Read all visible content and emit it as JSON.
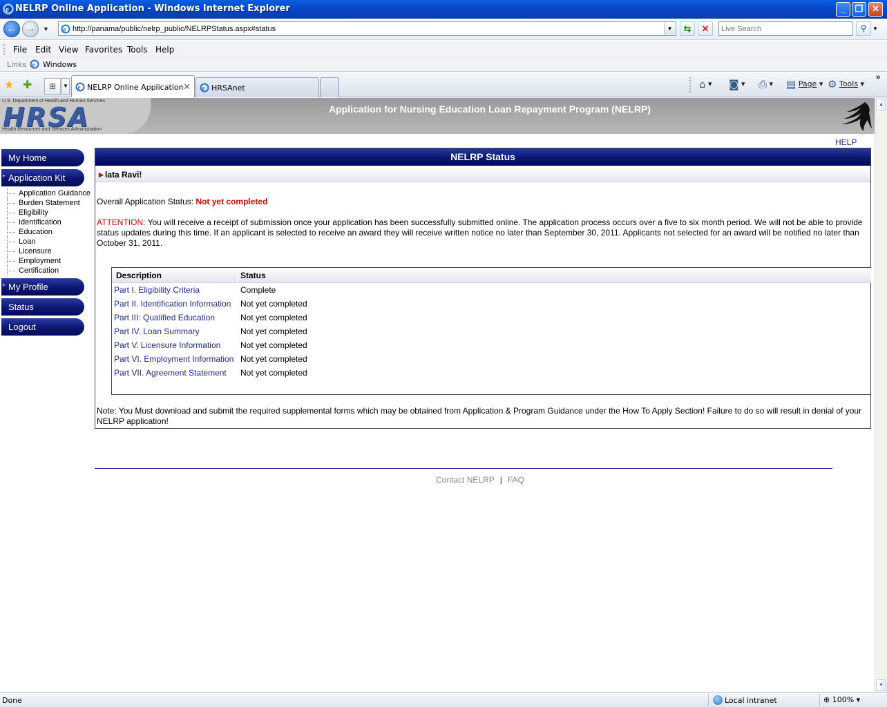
{
  "window": {
    "title": "NELRP Online Application - Windows Internet Explorer",
    "minimize": "_",
    "maximize": "❐",
    "close": "✕"
  },
  "addressbar": {
    "url": "http://panama/public/nelrp_public/NELRPStatus.aspx#status",
    "search_placeholder": "Live Search"
  },
  "menu": {
    "items": [
      "File",
      "Edit",
      "View",
      "Favorites",
      "Tools",
      "Help"
    ]
  },
  "links_bar": {
    "label": "Links",
    "link": "Windows"
  },
  "tabs": [
    {
      "label": "NELRP Online Application",
      "active": true
    },
    {
      "label": "HRSAnet",
      "active": false
    }
  ],
  "command_bar": {
    "page": "Page",
    "tools": "Tools"
  },
  "header": {
    "dept": "U.S. Department of Health and Human Services",
    "logo": "HRSA",
    "agency": "Health Resources and Services Administration",
    "app_title": "Application for Nursing Education Loan Repayment Program (NELRP)",
    "help": "HELP"
  },
  "sidebar": {
    "my_home": "My Home",
    "application_kit": "Application Kit",
    "kit_items": [
      "Application Guidance",
      "Burden Statement",
      "Eligibility",
      "Identification",
      "Education",
      "Loan",
      "Licensure",
      "Employment",
      "Certification"
    ],
    "my_profile": "My Profile",
    "status": "Status",
    "logout": "Logout",
    "plus": "+"
  },
  "panel": {
    "title": "NELRP Status",
    "greeting": "lata Ravi!",
    "overall_label": "Overall Application Status:",
    "overall_value": "Not yet completed",
    "attention_label": "ATTENTION:",
    "attention_text": "You will receive a receipt of submission once your application has been successfully submitted online. The application process occurs over a five to six month period. We will not be able to provide status updates during this time. If an applicant is selected to receive an award they will receive written notice no later than September 30, 2011. Applicants not selected for an award will be notified no later than October 31, 2011.",
    "table": {
      "headers": {
        "description": "Description",
        "status": "Status"
      },
      "rows": [
        {
          "description": "Part I. Eligibility Criteria",
          "status": "Complete"
        },
        {
          "description": "Part II. Identification Information",
          "status": "Not yet completed"
        },
        {
          "description": "Part III: Qualified Education",
          "status": "Not yet completed"
        },
        {
          "description": "Part IV. Loan Summary",
          "status": "Not yet completed"
        },
        {
          "description": "Part V. Licensure Information",
          "status": "Not yet completed"
        },
        {
          "description": "Part VI. Employment Information",
          "status": "Not yet completed"
        },
        {
          "description": "Part VII. Agreement Statement",
          "status": "Not yet completed"
        }
      ]
    },
    "note": "Note: You Must download and submit the required supplemental forms which may be obtained from Application & Program Guidance under the How To Apply Section! Failure to do so will result in denial of your NELRP application!"
  },
  "footer": {
    "contact": "Contact NELRP",
    "separator": "|",
    "faq": "FAQ"
  },
  "statusbar": {
    "status": "Done",
    "zone": "Local intranet",
    "zoom": "100%"
  }
}
